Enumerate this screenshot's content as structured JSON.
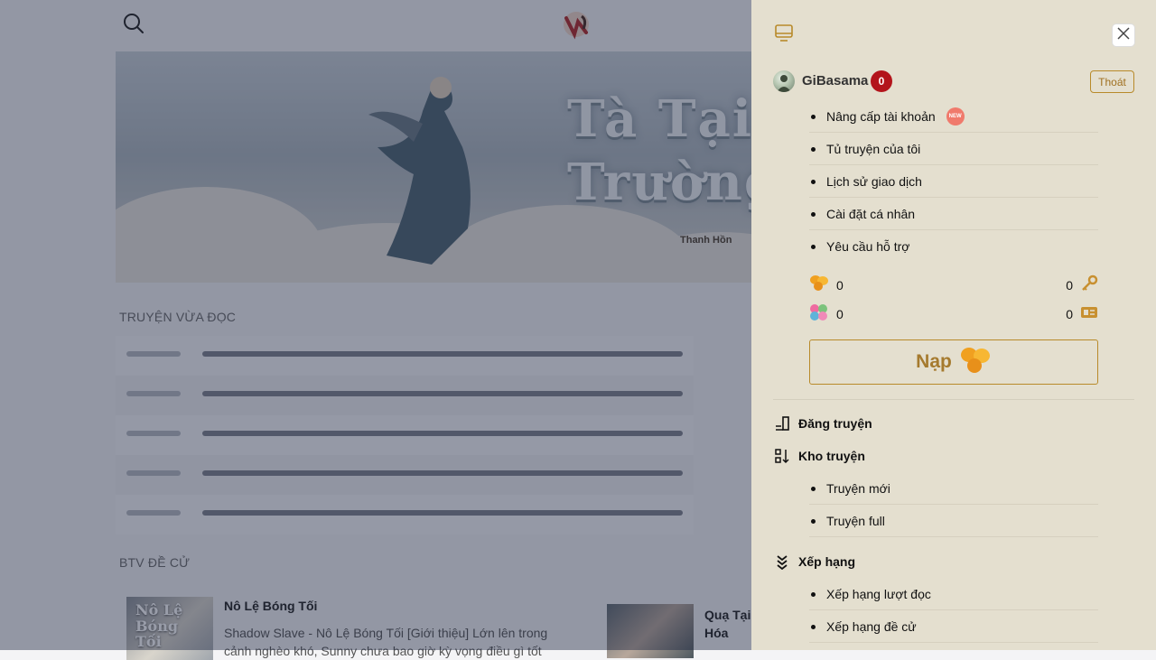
{
  "background_page": {
    "banner": {
      "title_line1": "Tà Tại Đạ",
      "title_line2": "Trường Sin",
      "credit": "Thanh Hồn"
    },
    "recent_section_title": "TRUYỆN VỪA ĐỌC",
    "recommend_section_title": "BTV ĐỀ CỬ",
    "recommend": [
      {
        "cover_text": "Nô Lệ Bóng Tối",
        "title": "Nô Lệ Bóng Tối",
        "desc": "Shadow Slave - Nô Lệ Bóng Tối [Giới thiệu] Lớn lên trong cảnh nghèo khó, Sunny chưa bao giờ kỳ vọng điều gì tốt"
      },
      {
        "title": "Quạ Tại Hóa"
      }
    ]
  },
  "drawer": {
    "user": {
      "name": "GiBasama",
      "notif_count": "0",
      "logout_label": "Thoát"
    },
    "account_menu": [
      {
        "label": "Nâng cấp tài khoản",
        "badge": "NEW"
      },
      {
        "label": "Tủ truyện của tôi"
      },
      {
        "label": "Lịch sử giao dịch"
      },
      {
        "label": "Cài đặt cá nhân"
      },
      {
        "label": "Yêu cầu hỗ trợ"
      }
    ],
    "balances": {
      "flowers": "0",
      "keys": "0",
      "candies": "0",
      "tickets": "0"
    },
    "topup_label": "Nạp",
    "sections": {
      "upload": "Đăng truyện",
      "library": "Kho truyện",
      "library_items": [
        "Truyện mới",
        "Truyện full"
      ],
      "ranking": "Xếp hạng",
      "ranking_items": [
        "Xếp hạng lượt đọc",
        "Xếp hạng đề cử"
      ]
    },
    "colors": {
      "drawer_bg": "#e4dfcf",
      "accent_gold": "#b88a2a",
      "badge_red": "#b3141b",
      "overlay": "rgba(28,38,64,0.45)"
    },
    "icons": [
      "search-icon",
      "logo-icon",
      "monitor-icon",
      "close-icon",
      "flower-icon",
      "key-icon",
      "candy-icon",
      "ticket-icon",
      "upload-icon",
      "sort-icon",
      "rank-icon"
    ]
  }
}
